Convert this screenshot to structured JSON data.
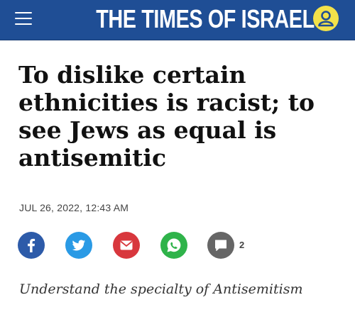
{
  "header": {
    "brand": "THE TIMES OF ISRAEL",
    "colors": {
      "bar": "#1f4e95",
      "account": "#f2e14a"
    },
    "icons": {
      "menu": "hamburger-menu-icon",
      "account": "user-account-icon"
    }
  },
  "article": {
    "headline": "To dislike certain ethnicities is racist; to see Jews as equal is antisemitic",
    "date": "JUL 26, 2022, 12:43 AM",
    "share": [
      {
        "icon": "facebook-icon",
        "color": "#2d5ba9"
      },
      {
        "icon": "twitter-icon",
        "color": "#2a9ae5"
      },
      {
        "icon": "email-icon",
        "color": "#d8373d"
      },
      {
        "icon": "whatsapp-icon",
        "color": "#2fb34a"
      },
      {
        "icon": "comment-icon",
        "color": "#666666"
      }
    ],
    "comment_count": "2",
    "subheading": "Understand the specialty of Antisemitism"
  }
}
